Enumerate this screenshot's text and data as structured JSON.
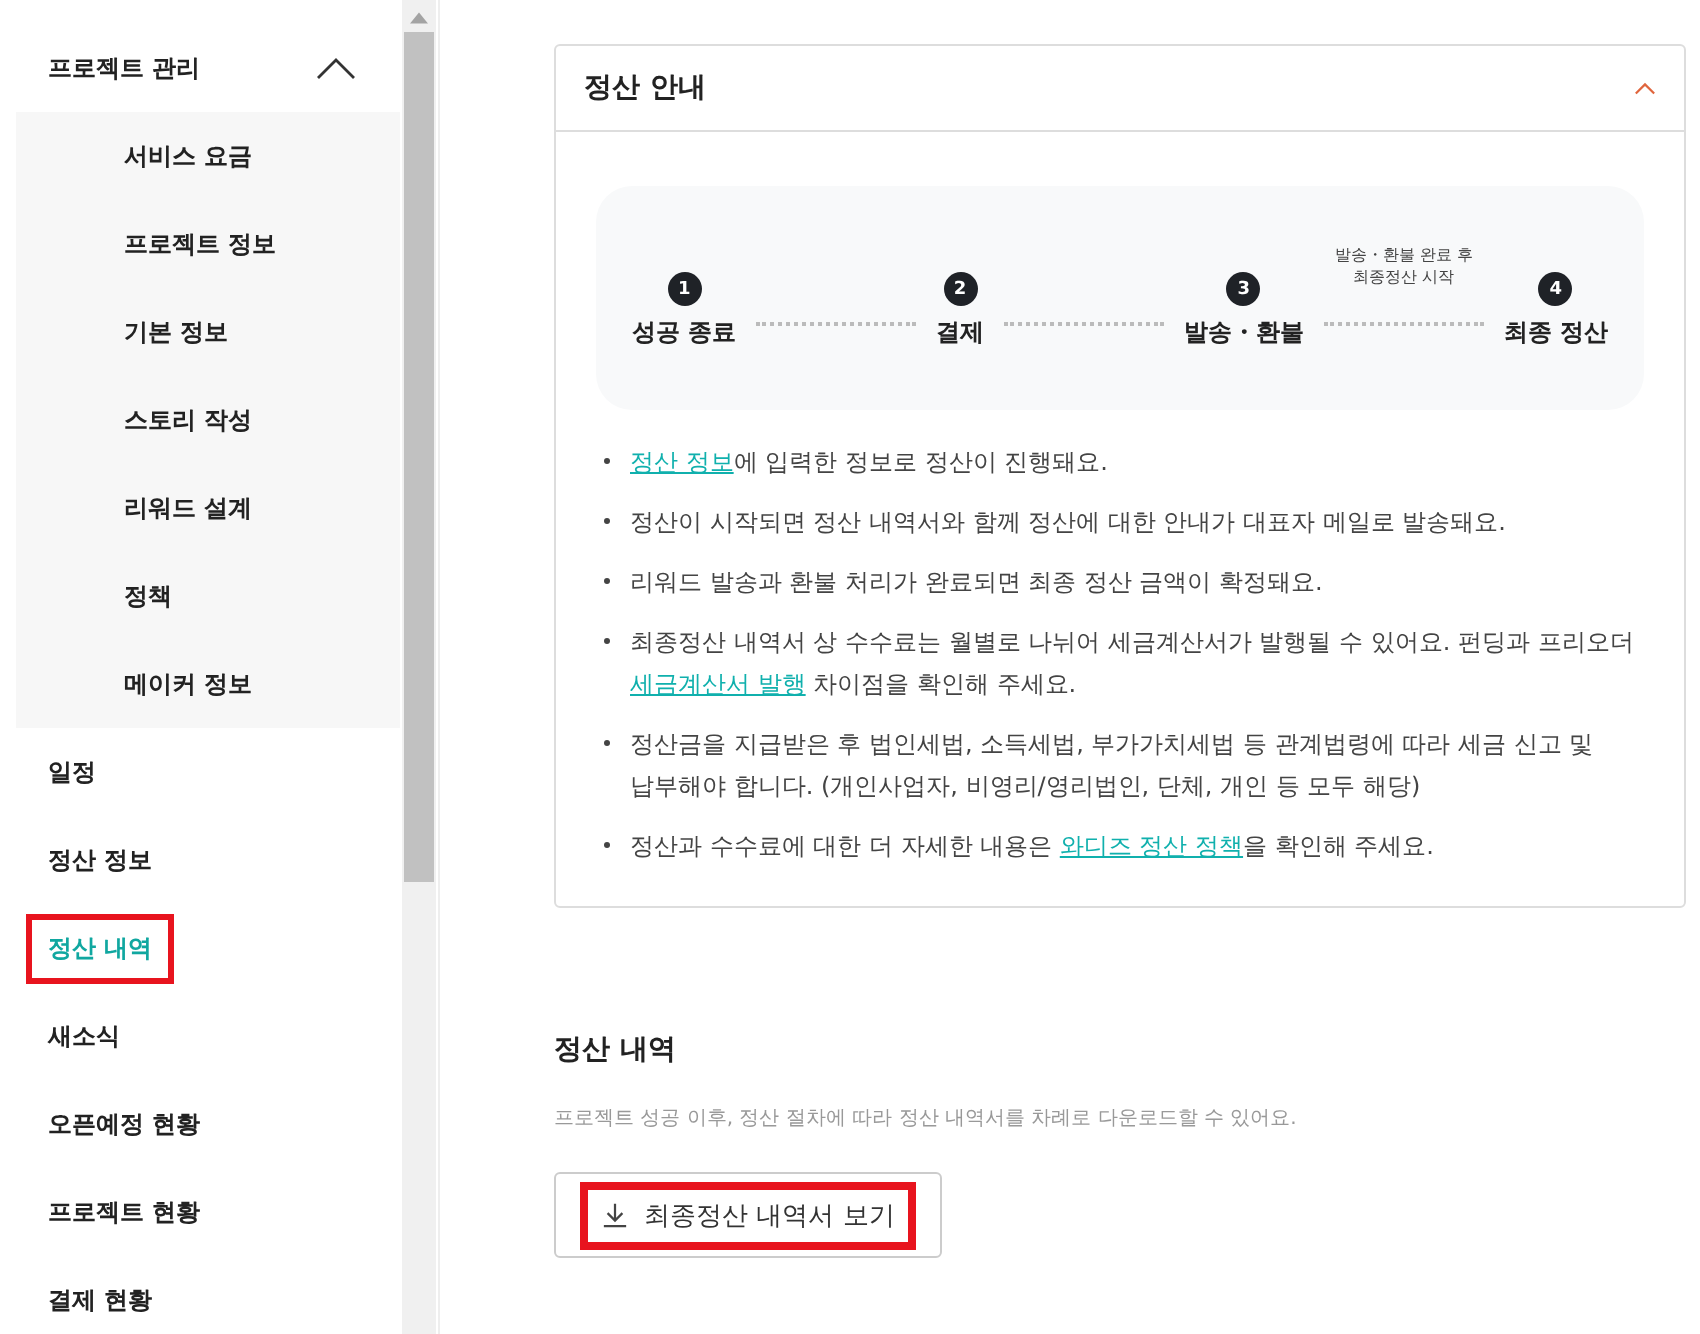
{
  "sidebar": {
    "items": [
      {
        "label": "프로젝트 관리",
        "expanded": true,
        "selected": false,
        "highlighted": false,
        "children": [
          {
            "label": "서비스 요금",
            "selected": false,
            "highlighted": false
          },
          {
            "label": "프로젝트 정보",
            "selected": false,
            "highlighted": false
          },
          {
            "label": "기본 정보",
            "selected": false,
            "highlighted": false
          },
          {
            "label": "스토리 작성",
            "selected": false,
            "highlighted": false
          },
          {
            "label": "리워드 설계",
            "selected": false,
            "highlighted": false
          },
          {
            "label": "정책",
            "selected": false,
            "highlighted": false
          },
          {
            "label": "메이커 정보",
            "selected": false,
            "highlighted": false
          }
        ]
      },
      {
        "label": "일정",
        "selected": false,
        "highlighted": false
      },
      {
        "label": "정산 정보",
        "selected": false,
        "highlighted": false
      },
      {
        "label": "정산 내역",
        "selected": true,
        "highlighted": true
      },
      {
        "label": "새소식",
        "selected": false,
        "highlighted": false
      },
      {
        "label": "오픈예정 현황",
        "selected": false,
        "highlighted": false
      },
      {
        "label": "프로젝트 현황",
        "selected": false,
        "highlighted": false
      },
      {
        "label": "결제 현황",
        "selected": false,
        "highlighted": false
      }
    ]
  },
  "guide": {
    "title": "정산 안내",
    "expanded": true,
    "steps": [
      {
        "number": "1",
        "label": "성공 종료"
      },
      {
        "number": "2",
        "label": "결제"
      },
      {
        "number": "3",
        "label": "발송・환불"
      },
      {
        "number": "4",
        "label": "최종 정산",
        "note": "발송・환불 완료 후\n최종정산 시작"
      }
    ],
    "bullets": [
      [
        {
          "kind": "link",
          "text": "정산 정보"
        },
        {
          "kind": "plain",
          "text": "에 입력한 정보로 정산이 진행돼요."
        }
      ],
      [
        {
          "kind": "plain",
          "text": "정산이 시작되면 정산 내역서와 함께 정산에 대한 안내가 대표자 메일로 발송돼요."
        }
      ],
      [
        {
          "kind": "plain",
          "text": "리워드 발송과 환불 처리가 완료되면 최종 정산 금액이 확정돼요."
        }
      ],
      [
        {
          "kind": "plain",
          "text": "최종정산 내역서 상 수수료는 월별로 나뉘어 세금계산서가 발행될 수 있어요. 펀딩과 프리오더 "
        },
        {
          "kind": "link",
          "text": "세금계산서 발행"
        },
        {
          "kind": "plain",
          "text": " 차이점을 확인해 주세요."
        }
      ],
      [
        {
          "kind": "plain",
          "text": "정산금을 지급받은 후 법인세법, 소득세법, 부가가치세법 등 관계법령에 따라 세금 신고 및 납부해야 합니다. (개인사업자, 비영리/영리법인, 단체, 개인 등 모두 해당)"
        }
      ],
      [
        {
          "kind": "plain",
          "text": "정산과 수수료에 대한 더 자세한 내용은 "
        },
        {
          "kind": "link",
          "text": "와디즈 정산 정책"
        },
        {
          "kind": "plain",
          "text": "을 확인해 주세요."
        }
      ]
    ]
  },
  "history": {
    "title": "정산 내역",
    "description": "프로젝트 성공 이후, 정산 절차에 따라 정산 내역서를 차례로 다운로드할 수 있어요.",
    "button": {
      "label": "최종정산 내역서 보기",
      "highlighted": true
    }
  }
}
